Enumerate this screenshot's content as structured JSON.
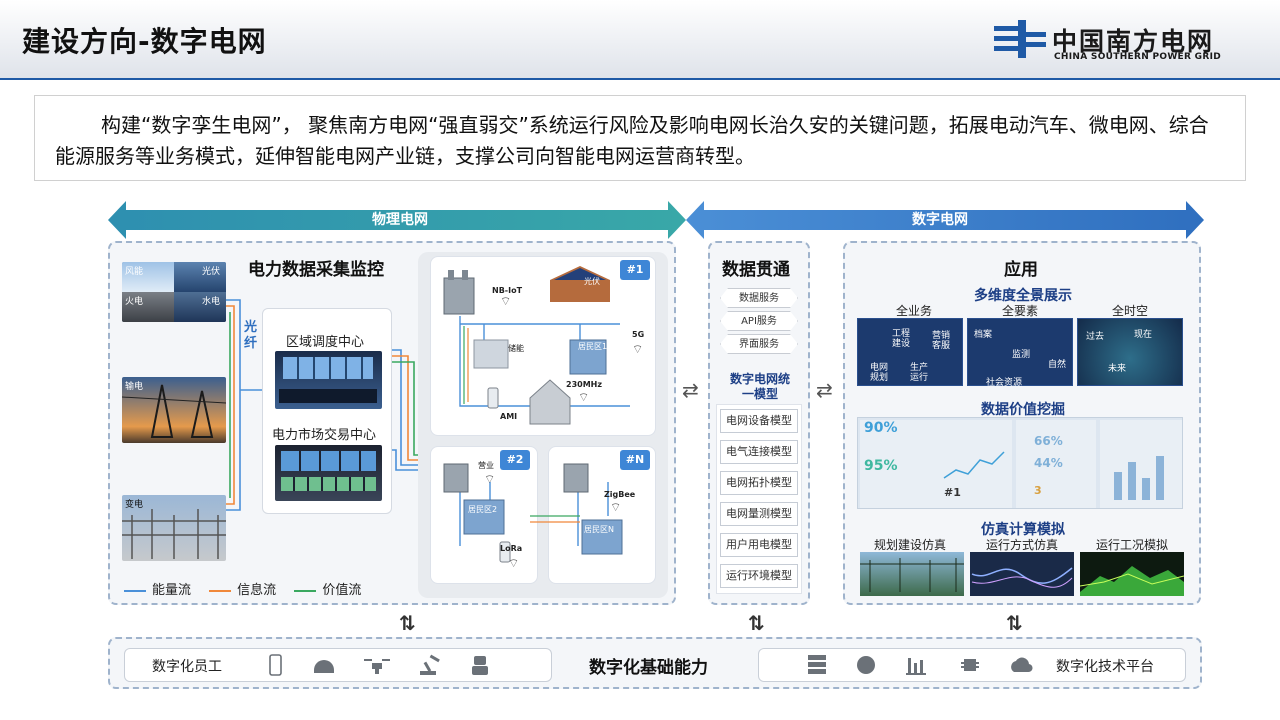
{
  "header": {
    "title": "建设方向-数字电网",
    "logo_cn": "中国南方电网",
    "logo_en": "CHINA SOUTHERN POWER GRID"
  },
  "intro": "构建“数字孪生电网”，  聚焦南方电网“强直弱交”系统运行风险及影响电网长治久安的关键问题，拓展电动汽车、微电网、综合能源服务等业务模式，延伸智能电网产业链，支撑公司向智能电网运营商转型。",
  "bands": {
    "physical": "物理电网",
    "digital": "数字电网"
  },
  "collect": {
    "title": "电力数据采集监控",
    "photos": [
      "风能",
      "光伏",
      "火电",
      "水电",
      "输电",
      "变电"
    ],
    "fiber": "光纤",
    "centers": [
      "区域调度中心",
      "电力市场交易中心"
    ],
    "legend": [
      "能量流",
      "信息流",
      "价值流"
    ],
    "network": {
      "tags": [
        "#1",
        "#2",
        "#N"
      ],
      "labels": [
        "NB-IoT",
        "光伏",
        "5G",
        "储能",
        "居民区1",
        "230MHz",
        "AMI",
        "营业",
        "居民区2",
        "LoRa",
        "ZigBee",
        "居民区N"
      ]
    }
  },
  "data_flow": {
    "title": "数据贯通",
    "services": [
      "数据服务",
      "API服务",
      "界面服务"
    ],
    "model_title": "数字电网统一模型",
    "models": [
      "电网设备模型",
      "电气连接模型",
      "电网拓扑模型",
      "电网量测模型",
      "用户用电模型",
      "运行环境模型"
    ]
  },
  "application": {
    "title": "应用",
    "panorama": {
      "title": "多维度全景展示",
      "cols": [
        "全业务",
        "全要素",
        "全时空"
      ],
      "biz_labels": [
        "工程建设",
        "营销客服",
        "电网规划",
        "生产运行"
      ],
      "element_labels": [
        "档案",
        "监测",
        "自然",
        "社会资源"
      ],
      "time_labels": [
        "过去",
        "现在",
        "未来"
      ]
    },
    "mining": {
      "title": "数据价值挖掘",
      "values": [
        "90%",
        "95%",
        "66%",
        "44%",
        "#1",
        "3"
      ]
    },
    "simulation": {
      "title": "仿真计算模拟",
      "items": [
        "规划建设仿真",
        "运行方式仿真",
        "运行工况模拟"
      ]
    }
  },
  "foundation": {
    "title": "数字化基础能力",
    "left": "数字化员工",
    "right": "数字化技术平台",
    "left_icons": [
      "phone-icon",
      "helmet-icon",
      "drone-icon",
      "robot-arm-icon",
      "robot-icon"
    ],
    "right_icons": [
      "server-icon",
      "brain-icon",
      "chart-icon",
      "chip-icon",
      "cloud-icon"
    ]
  },
  "colors": {
    "accent": "#1f5aa6",
    "band_left": "#2c9aa8",
    "band_right": "#3a7fcb",
    "energy": "#4a90d9",
    "info": "#f0883a",
    "value": "#3aa860"
  }
}
